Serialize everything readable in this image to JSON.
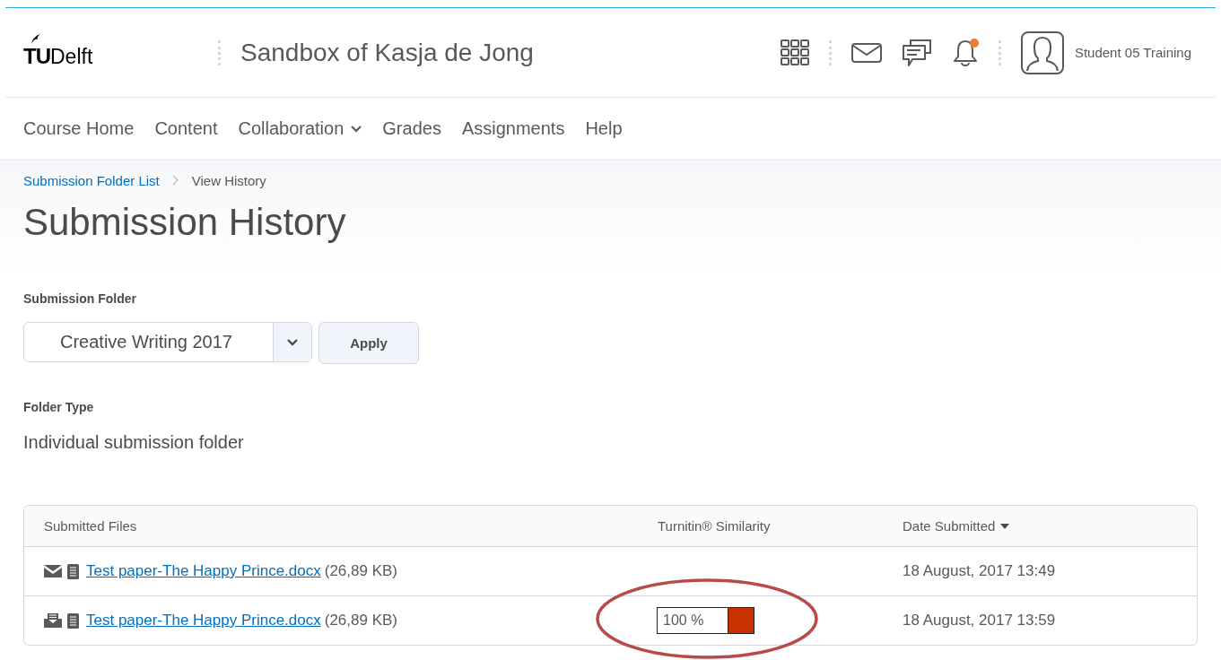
{
  "header": {
    "logo": {
      "tu": "TU",
      "name": "Delft"
    },
    "course_title": "Sandbox of Kasja de Jong",
    "notification_unread": true,
    "user": "Student 05 Training"
  },
  "nav": [
    {
      "label": "Course Home",
      "dropdown": false
    },
    {
      "label": "Content",
      "dropdown": false
    },
    {
      "label": "Collaboration",
      "dropdown": true
    },
    {
      "label": "Grades",
      "dropdown": false
    },
    {
      "label": "Assignments",
      "dropdown": false
    },
    {
      "label": "Help",
      "dropdown": false
    }
  ],
  "breadcrumbs": [
    {
      "label": "Submission Folder List",
      "link": true
    },
    {
      "label": "View History",
      "link": false
    }
  ],
  "page_title": "Submission History",
  "folder_select": {
    "label": "Submission Folder",
    "value": "Creative Writing 2017",
    "button": "Apply"
  },
  "folder_type": {
    "label": "Folder Type",
    "value": "Individual submission folder"
  },
  "table": {
    "columns": [
      {
        "label": "Submitted Files",
        "sorted": false
      },
      {
        "label": "Turnitin® Similarity",
        "sorted": false
      },
      {
        "label": "Date Submitted",
        "sorted": true
      }
    ],
    "rows": [
      {
        "kind": "mail",
        "file": "Test paper-The Happy Prince.docx",
        "size": "(26,89 KB)",
        "date": "18 August, 2017 13:49"
      },
      {
        "kind": "inbox",
        "file": "Test paper-The Happy Prince.docx",
        "size": "(26,89 KB)",
        "similarity": {
          "text": "100 %",
          "color": "#c83200"
        },
        "circled": true,
        "date": "18 August, 2017 13:59"
      }
    ]
  }
}
